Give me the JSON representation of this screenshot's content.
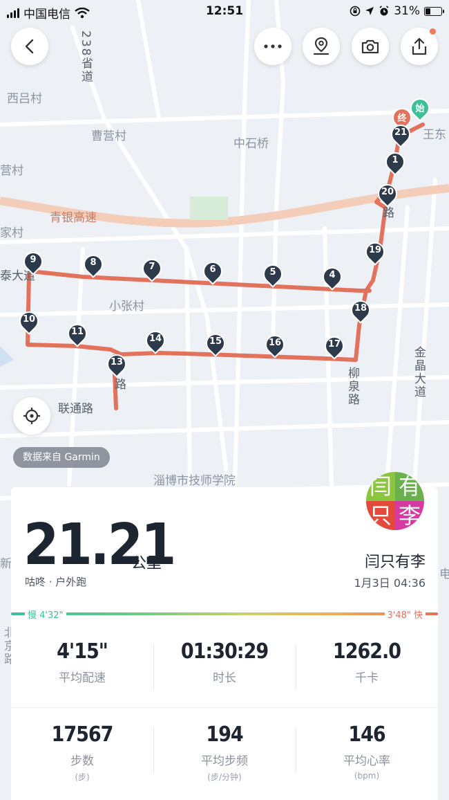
{
  "status_bar": {
    "carrier": "中国电信",
    "time": "12:51",
    "battery": "31%",
    "battery_level": 0.31
  },
  "map": {
    "labels": {
      "road_238": "238省道",
      "xilv": "西吕村",
      "caoying": "曹营村",
      "zhongshiqiao": "中石桥",
      "wangdong": "王东",
      "ying": "营村",
      "jia": "家村",
      "qingyin": "青银高速",
      "tai_da_dao": "泰大道",
      "xiaozhang": "小张村",
      "liuquan": "柳泉路",
      "jinjing": "金晶大道",
      "liantong": "联通路",
      "lu_small": "路",
      "jishi": "淄博市技师学院",
      "lu_right": "路",
      "xin": "新",
      "bei_jing": "北京路",
      "dian": "电"
    },
    "markers": {
      "start": "始",
      "end": "终",
      "km": [
        "1",
        "4",
        "5",
        "6",
        "7",
        "8",
        "9",
        "10",
        "11",
        "13",
        "14",
        "15",
        "16",
        "17",
        "18",
        "19",
        "20",
        "21"
      ]
    }
  },
  "buttons": {
    "source": "数据来自 Garmin"
  },
  "activity": {
    "distance": "21.21",
    "distance_unit": "公里",
    "app_type": "咕咚 · 户外跑",
    "user_name": "闫只有李",
    "date_time": "1月3日 04:36",
    "avatar_chars": [
      "闫",
      "有",
      "只",
      "李"
    ],
    "pace_slow": "慢 4'32\"",
    "pace_fast": "3'48\" 快",
    "stats_row1": [
      {
        "value": "4'15\"",
        "label": "平均配速",
        "unit": ""
      },
      {
        "value": "01:30:29",
        "label": "时长",
        "unit": ""
      },
      {
        "value": "1262.0",
        "label": "千卡",
        "unit": ""
      }
    ],
    "stats_row2": [
      {
        "value": "17567",
        "label": "步数",
        "unit": "(步)"
      },
      {
        "value": "194",
        "label": "平均步频",
        "unit": "(步/分钟)"
      },
      {
        "value": "146",
        "label": "平均心率",
        "unit": "(bpm)"
      }
    ]
  },
  "colors": {
    "route": "#e2725b",
    "marker": "#2d3a4c",
    "start": "#3cc09a",
    "highway": "#f4cdb8"
  }
}
